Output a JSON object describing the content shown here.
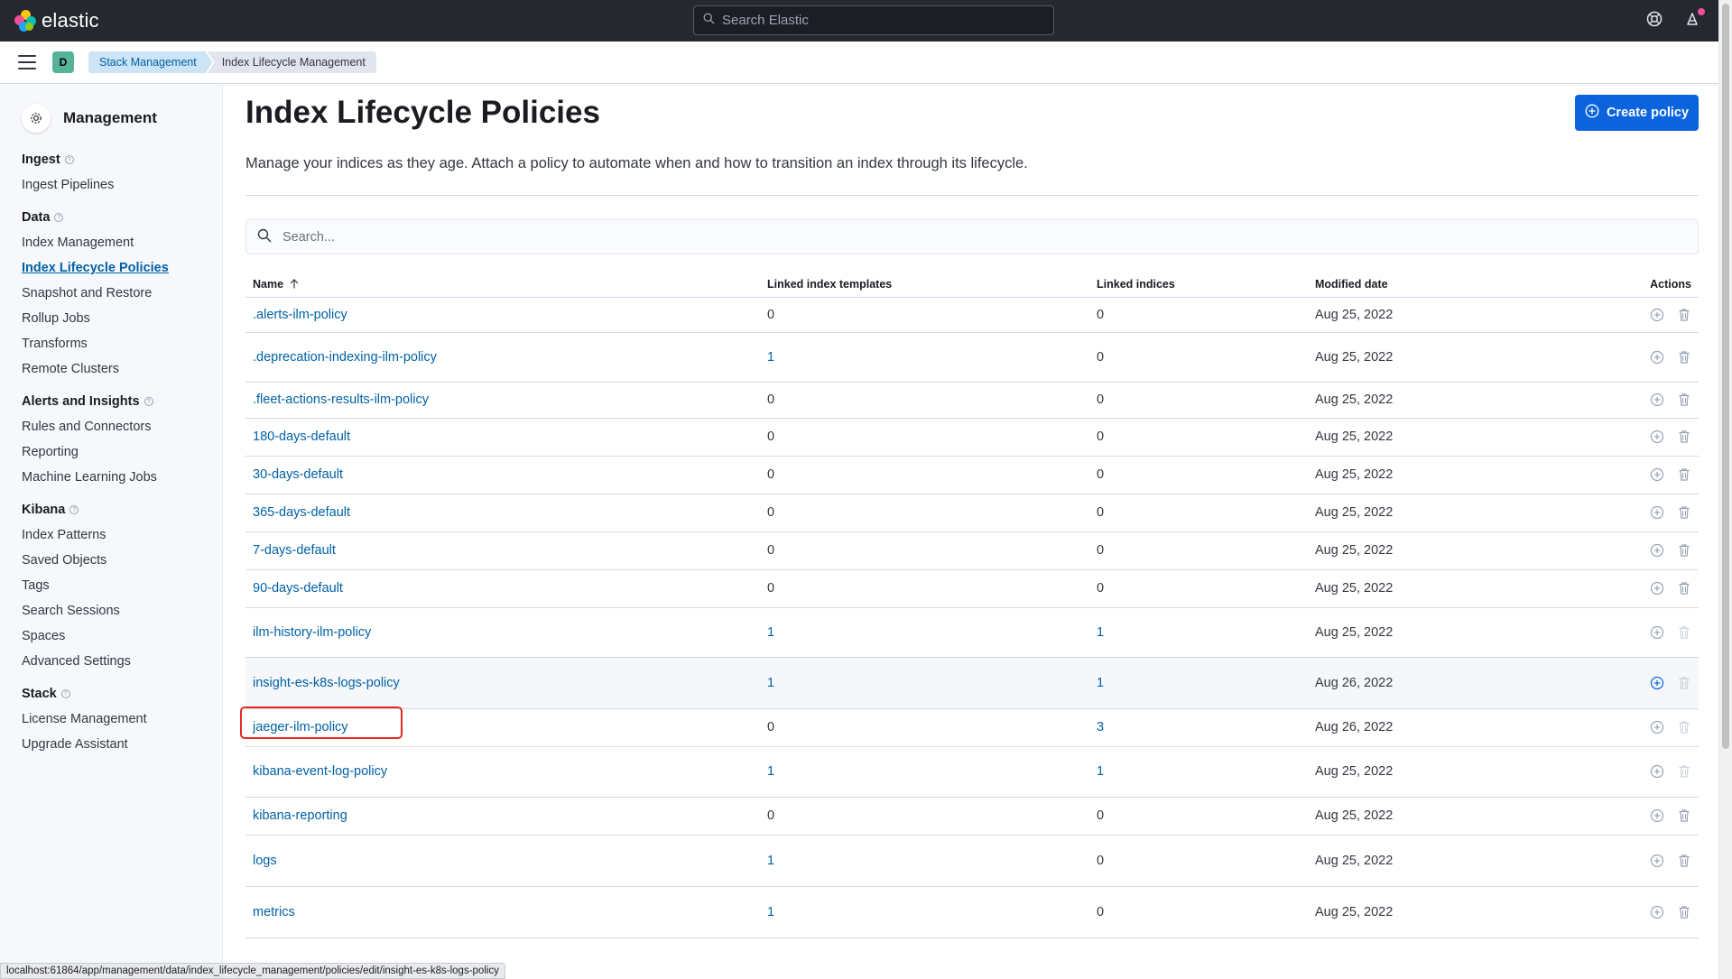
{
  "app": {
    "logo_text": "elastic",
    "search_placeholder": "Search Elastic",
    "space_initial": "D"
  },
  "breadcrumbs": [
    "Stack Management",
    "Index Lifecycle Management"
  ],
  "sidebar": {
    "title": "Management",
    "groups": [
      {
        "title": "Ingest",
        "items": [
          "Ingest Pipelines"
        ]
      },
      {
        "title": "Data",
        "items": [
          "Index Management",
          "Index Lifecycle Policies",
          "Snapshot and Restore",
          "Rollup Jobs",
          "Transforms",
          "Remote Clusters"
        ]
      },
      {
        "title": "Alerts and Insights",
        "items": [
          "Rules and Connectors",
          "Reporting",
          "Machine Learning Jobs"
        ]
      },
      {
        "title": "Kibana",
        "items": [
          "Index Patterns",
          "Saved Objects",
          "Tags",
          "Search Sessions",
          "Spaces",
          "Advanced Settings"
        ]
      },
      {
        "title": "Stack",
        "items": [
          "License Management",
          "Upgrade Assistant"
        ]
      }
    ],
    "active_item": "Index Lifecycle Policies"
  },
  "page": {
    "title": "Index Lifecycle Policies",
    "create_button": "Create policy",
    "description": "Manage your indices as they age. Attach a policy to automate when and how to transition an index through its lifecycle.",
    "search_placeholder": "Search..."
  },
  "table": {
    "columns": [
      "Name",
      "Linked index templates",
      "Linked indices",
      "Modified date",
      "Actions"
    ],
    "sort_column": "Name",
    "sort_direction": "ascending",
    "rows": [
      {
        "name": ".alerts-ilm-policy",
        "templates": "0",
        "indices": "0",
        "modified": "Aug 25, 2022"
      },
      {
        "name": ".deprecation-indexing-ilm-policy",
        "templates": "1",
        "indices": "0",
        "modified": "Aug 25, 2022"
      },
      {
        "name": ".fleet-actions-results-ilm-policy",
        "templates": "0",
        "indices": "0",
        "modified": "Aug 25, 2022"
      },
      {
        "name": "180-days-default",
        "templates": "0",
        "indices": "0",
        "modified": "Aug 25, 2022"
      },
      {
        "name": "30-days-default",
        "templates": "0",
        "indices": "0",
        "modified": "Aug 25, 2022"
      },
      {
        "name": "365-days-default",
        "templates": "0",
        "indices": "0",
        "modified": "Aug 25, 2022"
      },
      {
        "name": "7-days-default",
        "templates": "0",
        "indices": "0",
        "modified": "Aug 25, 2022"
      },
      {
        "name": "90-days-default",
        "templates": "0",
        "indices": "0",
        "modified": "Aug 25, 2022"
      },
      {
        "name": "ilm-history-ilm-policy",
        "templates": "1",
        "indices": "1",
        "modified": "Aug 25, 2022"
      },
      {
        "name": "insight-es-k8s-logs-policy",
        "templates": "1",
        "indices": "1",
        "modified": "Aug 26, 2022"
      },
      {
        "name": "jaeger-ilm-policy",
        "templates": "0",
        "indices": "3",
        "modified": "Aug 26, 2022"
      },
      {
        "name": "kibana-event-log-policy",
        "templates": "1",
        "indices": "1",
        "modified": "Aug 25, 2022"
      },
      {
        "name": "kibana-reporting",
        "templates": "0",
        "indices": "0",
        "modified": "Aug 25, 2022"
      },
      {
        "name": "logs",
        "templates": "1",
        "indices": "0",
        "modified": "Aug 25, 2022"
      },
      {
        "name": "metrics",
        "templates": "1",
        "indices": "0",
        "modified": "Aug 25, 2022"
      }
    ]
  },
  "status_url": "localhost:61864/app/management/data/index_lifecycle_management/policies/edit/insight-es-k8s-logs-policy",
  "colors": {
    "header_bg": "#25282f",
    "link": "#0061a6",
    "primary_button": "#0b64dd",
    "highlight_box": "#e0291f"
  }
}
